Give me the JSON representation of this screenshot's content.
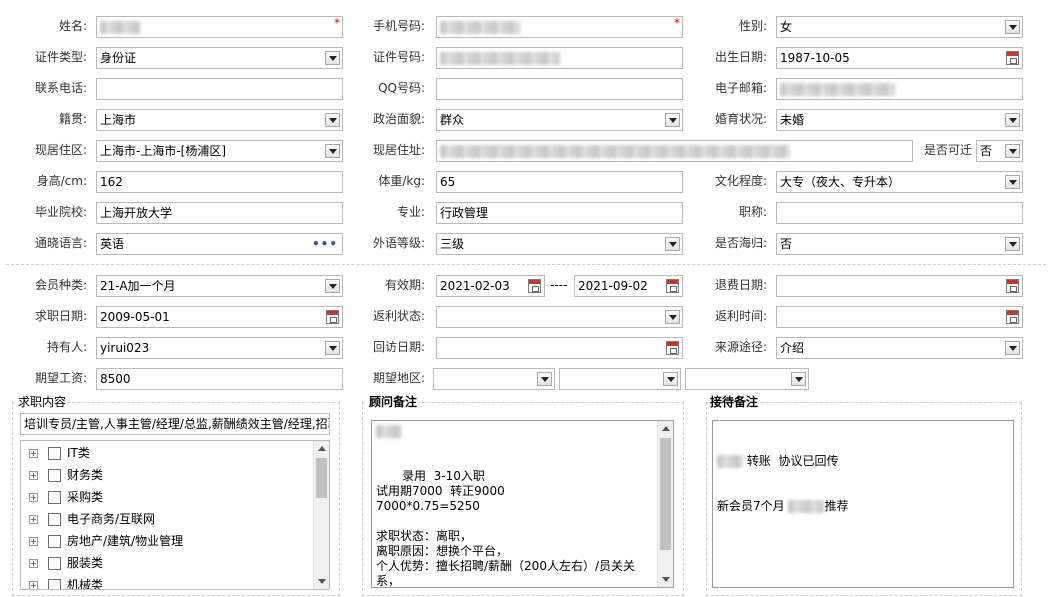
{
  "form": {
    "name": {
      "label": "姓名:",
      "value": "",
      "required": "*"
    },
    "mobile": {
      "label": "手机号码:",
      "value": "",
      "required": "*"
    },
    "gender": {
      "label": "性别:",
      "value": "女"
    },
    "id_type": {
      "label": "证件类型:",
      "value": "身份证"
    },
    "id_number": {
      "label": "证件号码:",
      "value": ""
    },
    "birth_date": {
      "label": "出生日期:",
      "value": "1987-10-05"
    },
    "contact_phone": {
      "label": "联系电话:",
      "value": ""
    },
    "qq": {
      "label": "QQ号码:",
      "value": ""
    },
    "email": {
      "label": "电子邮箱:",
      "value": ""
    },
    "native_place": {
      "label": "籍贯:",
      "value": "上海市"
    },
    "political_status": {
      "label": "政治面貌:",
      "value": "群众"
    },
    "marital_status": {
      "label": "婚育状况:",
      "value": "未婚"
    },
    "residence_area": {
      "label": "现居住区:",
      "value": "上海市-上海市-[杨浦区]"
    },
    "residence_address": {
      "label": "现居住址:",
      "value": ""
    },
    "relocatable": {
      "label": "是否可迁",
      "value": "否"
    },
    "height": {
      "label": "身高/cm:",
      "value": "162"
    },
    "weight": {
      "label": "体重/kg:",
      "value": "65"
    },
    "education": {
      "label": "文化程度:",
      "value": "大专（夜大、专升本）"
    },
    "school": {
      "label": "毕业院校:",
      "value": "上海开放大学"
    },
    "major": {
      "label": "专业:",
      "value": "行政管理"
    },
    "title": {
      "label": "职称:",
      "value": ""
    },
    "language": {
      "label": "通晓语言:",
      "value": "英语",
      "more": "•••"
    },
    "foreign_level": {
      "label": "外语等级:",
      "value": "三级"
    },
    "overseas": {
      "label": "是否海归:",
      "value": "否"
    }
  },
  "member": {
    "member_type": {
      "label": "会员种类:",
      "value": "21-A加一个月"
    },
    "valid_period": {
      "label": "有效期:",
      "start": "2021-02-03",
      "sep": "----",
      "end": "2021-09-02"
    },
    "refund_date": {
      "label": "退费日期:",
      "value": ""
    },
    "job_seek_date": {
      "label": "求职日期:",
      "value": "2009-05-01"
    },
    "rebate_status": {
      "label": "返利状态:",
      "value": ""
    },
    "rebate_time": {
      "label": "返利时间:",
      "value": ""
    },
    "holder": {
      "label": "持有人:",
      "value": "yirui023"
    },
    "visit_date": {
      "label": "回访日期:",
      "value": ""
    },
    "source": {
      "label": "来源途径:",
      "value": "介绍"
    },
    "expected_salary": {
      "label": "期望工资:",
      "value": "8500"
    },
    "expected_area": {
      "label": "期望地区:",
      "values": [
        "",
        "",
        ""
      ]
    }
  },
  "job_content": {
    "title": "求职内容",
    "summary": "培训专员/主管,人事主管/经理/总监,薪酬绩效主管/经理,招聘",
    "categories": [
      "IT类",
      "财务类",
      "采购类",
      "电子商务/互联网",
      "房地产/建筑/物业管理",
      "服装类",
      "机械类"
    ]
  },
  "advisor_notes": {
    "title": "顾问备注",
    "text": "录用  3-10入职\n试用期7000  转正9000\n7000*0.75=5250\n\n求职状态：离职，\n离职原因：想换个平台，\n个人优势：擅长招聘/薪酬（200人左右）/员关关系，\n推荐范围：想做全模块的职位，\n偏执行的多一些，行业不限制，规模大一点稳定些，"
  },
  "reception_notes": {
    "title": "接待备注",
    "line1": "转账  协议已回传",
    "line2": "新会员7个月",
    "line2b": "推荐"
  }
}
